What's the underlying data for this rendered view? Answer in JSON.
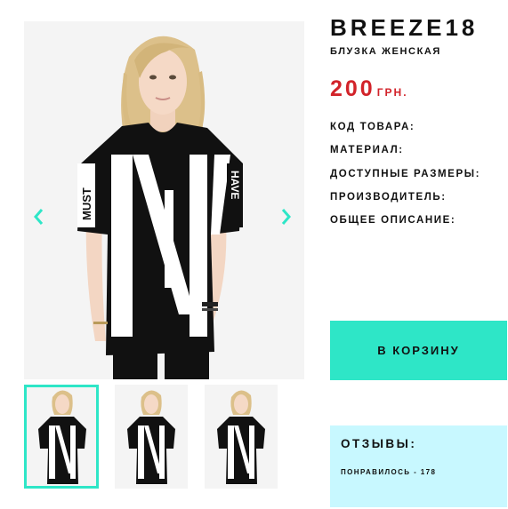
{
  "colors": {
    "accent": "#2ee6c7",
    "price": "#d2232a",
    "reviews_bg": "#c8f8ff",
    "swatches": [
      "#000000",
      "#f8f6c6",
      "#8a0f33"
    ]
  },
  "product": {
    "name": "BREEZE18",
    "category": "БЛУЗКА ЖЕНСКАЯ",
    "price_value": "200",
    "price_currency": "ГРН.",
    "specs": [
      "КОД ТОВАРА:",
      "МАТЕРИАЛ:",
      "ДОСТУПНЫЕ РАЗМЕРЫ:",
      "ПРОИЗВОДИТЕЛЬ:",
      "ОБЩЕЕ ОПИСАНИЕ:"
    ],
    "shirt_print": {
      "left_sleeve": "MUST",
      "right_sleeve": "HAVE",
      "front": "NY"
    }
  },
  "gallery": {
    "prev_icon": "chevron-left-icon",
    "next_icon": "chevron-right-icon",
    "thumbnail_count": 3,
    "active_thumbnail": 0
  },
  "actions": {
    "add_to_cart": "В КОРЗИНУ"
  },
  "reviews": {
    "title": "ОТЗЫВЫ:",
    "likes": "ПОНРАВИЛОСЬ - 178"
  }
}
